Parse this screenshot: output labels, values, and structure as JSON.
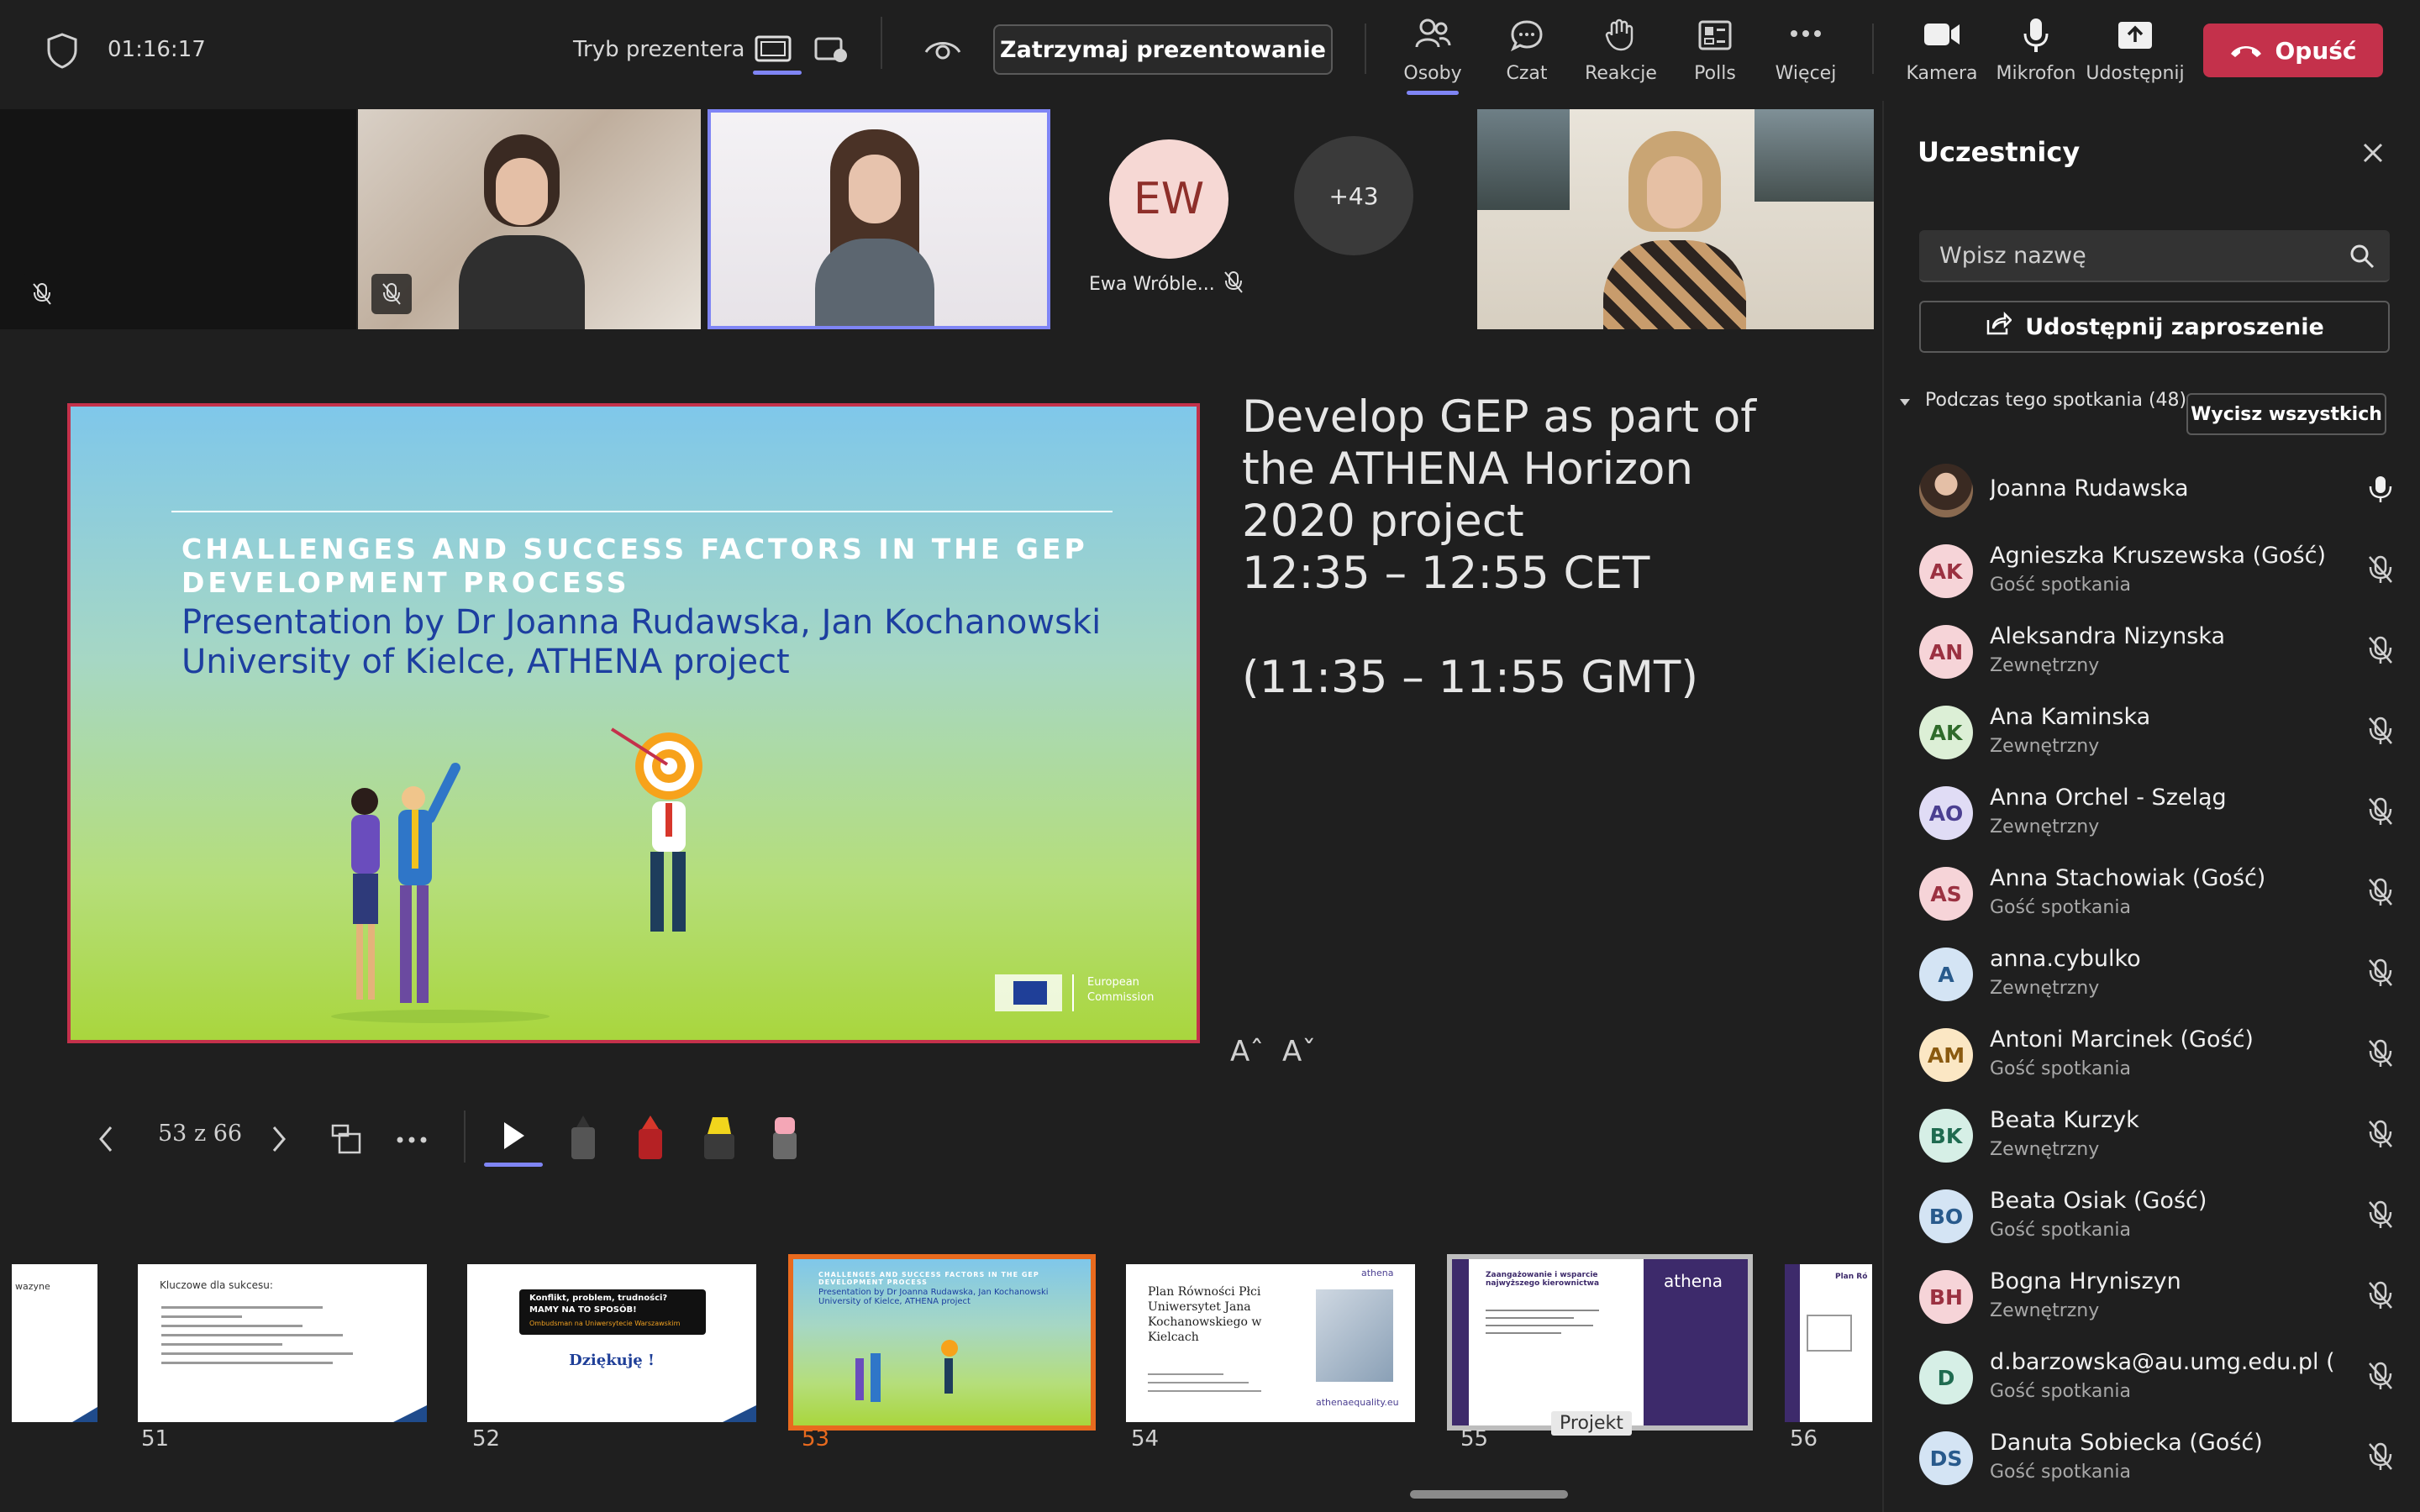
{
  "toolbar": {
    "timer": "01:16:17",
    "presenter_mode_label": "Tryb prezentera",
    "stop_presenting_label": "Zatrzymaj prezentowanie",
    "people_label": "Osoby",
    "chat_label": "Czat",
    "reactions_label": "Reakcje",
    "polls_label": "Polls",
    "more_label": "Więcej",
    "camera_label": "Kamera",
    "mic_label": "Mikrofon",
    "share_label": "Udostępnij",
    "leave_label": "Opuść"
  },
  "video_strip": {
    "ew_initials": "EW",
    "ew_name": "Ewa Wróble...",
    "overflow_count": "+43"
  },
  "slide": {
    "title": "CHALLENGES AND SUCCESS FACTORS IN THE GEP DEVELOPMENT PROCESS",
    "subtitle": "Presentation by Dr Joanna Rudawska, Jan Kochanowski University of Kielce, ATHENA project",
    "ec_label_1": "European",
    "ec_label_2": "Commission"
  },
  "notes": {
    "line1": "Develop GEP as part of the ATHENA Horizon 2020 project",
    "line2": "12:35 – 12:55 CET",
    "line3": "(11:35 – 11:55 GMT)",
    "font_up": "Aˆ",
    "font_down": "Aˇ"
  },
  "slide_controls": {
    "counter": "53 z 66"
  },
  "thumbnails": [
    {
      "num": "51",
      "title": "Kluczowe dla sukcesu:"
    },
    {
      "num": "52",
      "title": "Konflikt, problem, trudności? MAMY NA TO SPOSÓB!",
      "sub": "Ombudsman na Uniwersytecie Warszawskim",
      "thanks": "Dziękuję !"
    },
    {
      "num": "53",
      "title": "CHALLENGES AND SUCCESS FACTORS IN THE GEP DEVELOPMENT PROCESS",
      "sub": "Presentation by Dr Joanna Rudawska, Jan Kochanowski University of Kielce, ATHENA project"
    },
    {
      "num": "54",
      "title": "Plan Równości Płci Uniwersytet Jana Kochanowskiego w Kielcach",
      "sub": "athenaequality.eu",
      "logo": "athena"
    },
    {
      "num": "55",
      "title": "Zaangażowanie i wsparcie najwyższego kierownictwa",
      "logo": "athena",
      "tooltip": "Projekt"
    },
    {
      "num": "56",
      "title": "Plan Ró"
    }
  ],
  "panel": {
    "title": "Uczestnicy",
    "search_placeholder": "Wpisz nazwę",
    "share_invite": "Udostępnij zaproszenie",
    "section": "Podczas tego spotkania (48)",
    "mute_all": "Wycisz wszystkich",
    "participants": [
      {
        "initials": "",
        "name": "Joanna Rudawska",
        "role": "",
        "photo": true,
        "mic": "on"
      },
      {
        "initials": "AK",
        "name": "Agnieszka Kruszewska (Gość)",
        "role": "Gość spotkania",
        "color": "#f6d4d8",
        "fg": "#9b3141"
      },
      {
        "initials": "AN",
        "name": "Aleksandra Nizynska",
        "role": "Zewnętrzny",
        "color": "#f6d4d8",
        "fg": "#9b3141"
      },
      {
        "initials": "AK",
        "name": "Ana Kaminska",
        "role": "Zewnętrzny",
        "color": "#dcefd6",
        "fg": "#2f6b2a"
      },
      {
        "initials": "AO",
        "name": "Anna Orchel - Szeląg",
        "role": "Zewnętrzny",
        "color": "#e0dcf5",
        "fg": "#4b3f91"
      },
      {
        "initials": "AS",
        "name": "Anna Stachowiak (Gość)",
        "role": "Gość spotkania",
        "color": "#f6d4d8",
        "fg": "#9b3141"
      },
      {
        "initials": "A",
        "name": "anna.cybulko",
        "role": "Zewnętrzny",
        "color": "#d4e4f4",
        "fg": "#285a8c"
      },
      {
        "initials": "AM",
        "name": "Antoni Marcinek (Gość)",
        "role": "Gość spotkania",
        "color": "#fbe7c4",
        "fg": "#8a5a10"
      },
      {
        "initials": "BK",
        "name": "Beata Kurzyk",
        "role": "Zewnętrzny",
        "color": "#d6efe6",
        "fg": "#1f6b50"
      },
      {
        "initials": "BO",
        "name": "Beata Osiak (Gość)",
        "role": "Gość spotkania",
        "color": "#d4e4f4",
        "fg": "#285a8c"
      },
      {
        "initials": "BH",
        "name": "Bogna Hryniszyn",
        "role": "Zewnętrzny",
        "color": "#f6d4d8",
        "fg": "#9b3141"
      },
      {
        "initials": "D",
        "name": "d.barzowska@au.umg.edu.pl (G...",
        "role": "Gość spotkania",
        "color": "#d6efe6",
        "fg": "#1f6b50"
      },
      {
        "initials": "DS",
        "name": "Danuta Sobiecka (Gość)",
        "role": "Gość spotkania",
        "color": "#d4e4f4",
        "fg": "#285a8c"
      }
    ]
  }
}
